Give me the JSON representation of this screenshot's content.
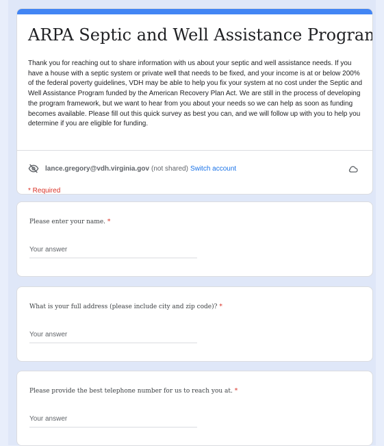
{
  "form": {
    "title": "ARPA Septic and Well Assistance Program",
    "description": "Thank you for reaching out to share information with us about your septic and well assistance needs.  If you have a house with a septic system or private well that needs to be fixed, and your income is at or below 200% of the federal poverty guidelines, VDH may be able to help you fix your system at no cost under the Septic and Well Assistance Program funded by the American Recovery Plan Act.  We are still in the process of developing the program framework, but we want to hear from you about your needs so we can help as soon as funding becomes available.  Please fill out this quick survey as best you can, and we will follow up with you to help you determine if you are eligible for funding.",
    "account": {
      "email": "lance.gregory@vdh.virginia.gov",
      "not_shared": "(not shared)",
      "switch_label": "Switch account"
    },
    "required_note": "* Required"
  },
  "questions": [
    {
      "label": "Please enter your name.",
      "required_mark": "*",
      "placeholder": "Your answer"
    },
    {
      "label": "What is your full address (please include city and zip code)?",
      "required_mark": "*",
      "placeholder": "Your answer"
    },
    {
      "label": "Please provide the best telephone number for us to reach you at.",
      "required_mark": "*",
      "placeholder": "Your answer"
    }
  ],
  "colors": {
    "accent": "#4285f4",
    "link": "#1a73e8",
    "required": "#d93025",
    "background": "#e8eefb"
  }
}
